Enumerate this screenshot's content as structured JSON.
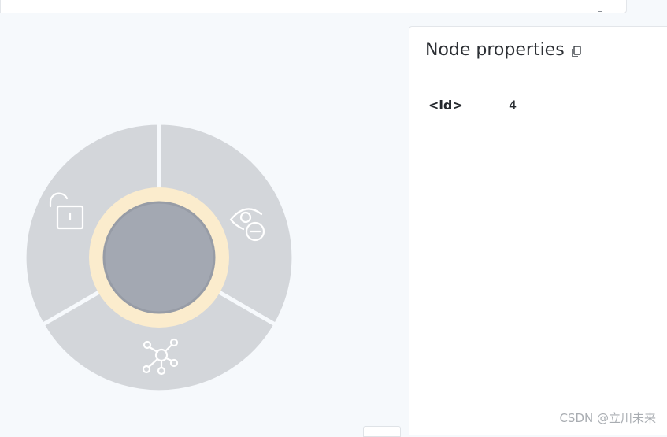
{
  "properties_panel": {
    "title": "Node properties",
    "copy_icon": "copy-icon",
    "rows": [
      {
        "key": "<id>",
        "value": "4"
      }
    ]
  },
  "radial_menu": {
    "segments": [
      {
        "name": "unlock",
        "icon": "unlock-icon"
      },
      {
        "name": "hide",
        "icon": "eye-minus-icon"
      },
      {
        "name": "expand",
        "icon": "network-icon"
      }
    ]
  },
  "colors": {
    "segment_fill": "#d3d6da",
    "segment_gap": "#f6f9fc",
    "node_ring": "#fbeccd",
    "node_fill": "#a3a8b2",
    "node_border": "#979ca6",
    "icon_stroke": "#ffffff"
  },
  "watermark": "CSDN @立川未来"
}
